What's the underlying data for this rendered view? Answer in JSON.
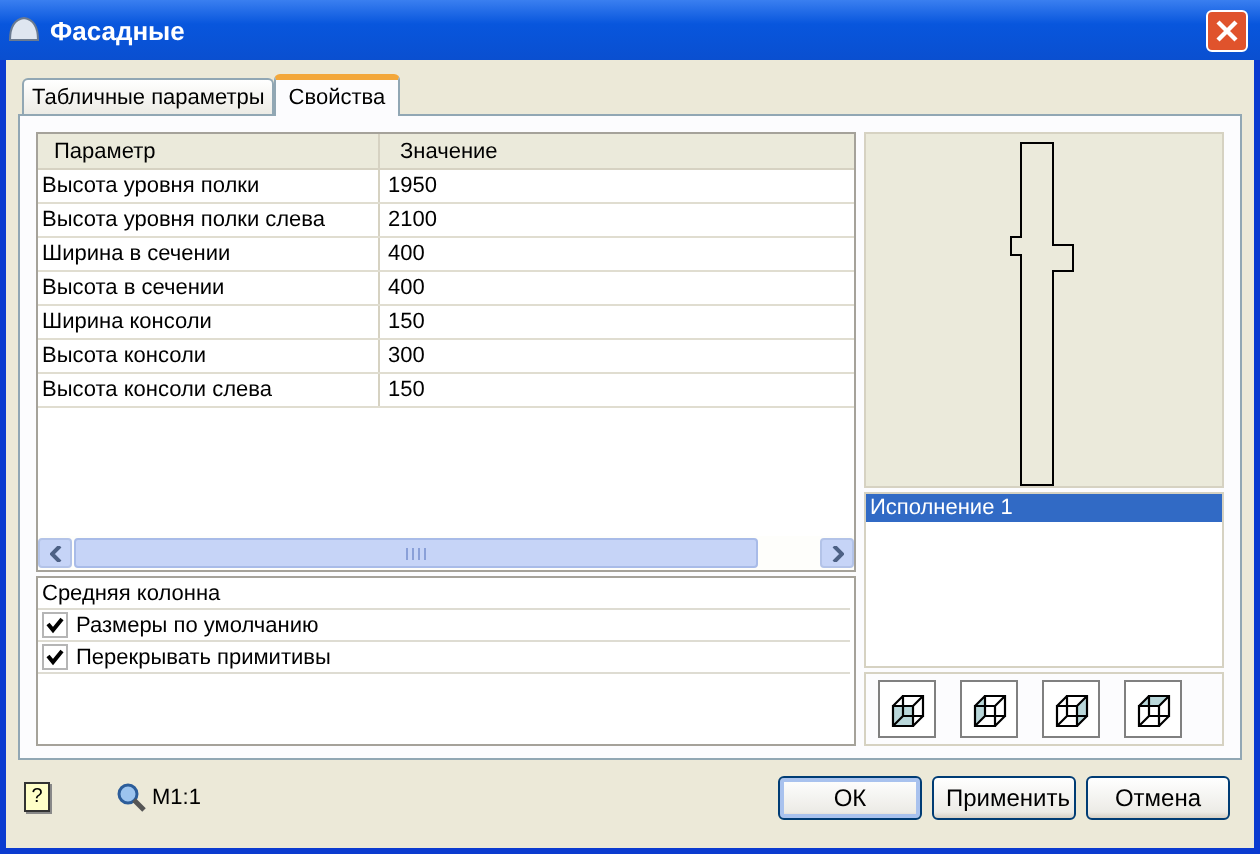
{
  "window": {
    "title": "Фасадные"
  },
  "tabs": [
    {
      "label": "Табличные параметры",
      "selected": false
    },
    {
      "label": "Свойства",
      "selected": true
    }
  ],
  "table": {
    "columns": [
      "Параметр",
      "Значение"
    ],
    "rows": [
      [
        "Высота уровня полки",
        "1950"
      ],
      [
        "Высота уровня полки слева",
        "2100"
      ],
      [
        "Ширина в сечении",
        "400"
      ],
      [
        "Высота в сечении",
        "400"
      ],
      [
        "Ширина консоли",
        "150"
      ],
      [
        "Высота консоли",
        "300"
      ],
      [
        "Высота консоли слева",
        "150"
      ]
    ]
  },
  "options": {
    "title": "Средняя колонна",
    "items": [
      {
        "label": "Размеры по умолчанию",
        "checked": true
      },
      {
        "label": "Перекрывать примитивы",
        "checked": true
      }
    ]
  },
  "variants": [
    {
      "label": "Исполнение 1",
      "selected": true
    }
  ],
  "view_buttons": [
    {
      "kind": "front"
    },
    {
      "kind": "left"
    },
    {
      "kind": "right"
    },
    {
      "kind": "top"
    }
  ],
  "help": "?",
  "scale": "М1:1",
  "buttons": [
    "ОК",
    "Применить",
    "Отмена"
  ]
}
